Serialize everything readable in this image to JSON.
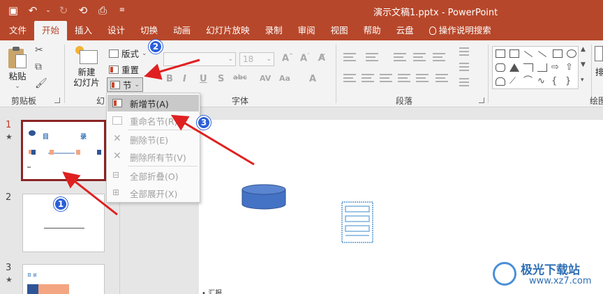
{
  "window": {
    "title": "演示文稿1.pptx  -  PowerPoint"
  },
  "tabs": [
    {
      "label": "文件"
    },
    {
      "label": "开始"
    },
    {
      "label": "插入"
    },
    {
      "label": "设计"
    },
    {
      "label": "切换"
    },
    {
      "label": "动画"
    },
    {
      "label": "幻灯片放映"
    },
    {
      "label": "录制"
    },
    {
      "label": "审阅"
    },
    {
      "label": "视图"
    },
    {
      "label": "帮助"
    },
    {
      "label": "云盘"
    },
    {
      "label": "操作说明搜索"
    }
  ],
  "ribbon": {
    "paste_label": "粘贴",
    "clipboard_group": "剪贴板",
    "new_slide_line1": "新建",
    "new_slide_line2": "幻灯片",
    "layout_label": "版式",
    "reset_label": "重置",
    "section_label": "节",
    "slides_group_partial": "幻",
    "font_size_value": "18",
    "font_group": "字体",
    "paragraph_group": "段落",
    "drawing_group_partial": "绘图",
    "arrange_partial": "排"
  },
  "section_menu": {
    "items": [
      {
        "label": "新增节(A)",
        "enabled": true
      },
      {
        "label": "重命名节(R)",
        "enabled": false
      },
      {
        "label": "删除节(E)",
        "enabled": false
      },
      {
        "label": "删除所有节(V)",
        "enabled": false
      },
      {
        "label": "全部折叠(O)",
        "enabled": false
      },
      {
        "label": "全部展开(X)",
        "enabled": false
      }
    ]
  },
  "slide_pane": {
    "slides": [
      {
        "number": "1",
        "star": "★",
        "title_left": "目",
        "title_right": "录"
      },
      {
        "number": "2"
      },
      {
        "number": "3",
        "star": "★",
        "title": "目 录"
      }
    ]
  },
  "slide": {
    "bullet_text": "汇报"
  },
  "annotations": {
    "badges": [
      "1",
      "2",
      "3"
    ],
    "arrow_color": "#e02020"
  },
  "watermark": {
    "text": "极光下载站",
    "url": "www.xz7.com"
  },
  "colors": {
    "accent": "#b7472a",
    "badge": "#2b5fd9",
    "cylinder": "#4472c4"
  }
}
